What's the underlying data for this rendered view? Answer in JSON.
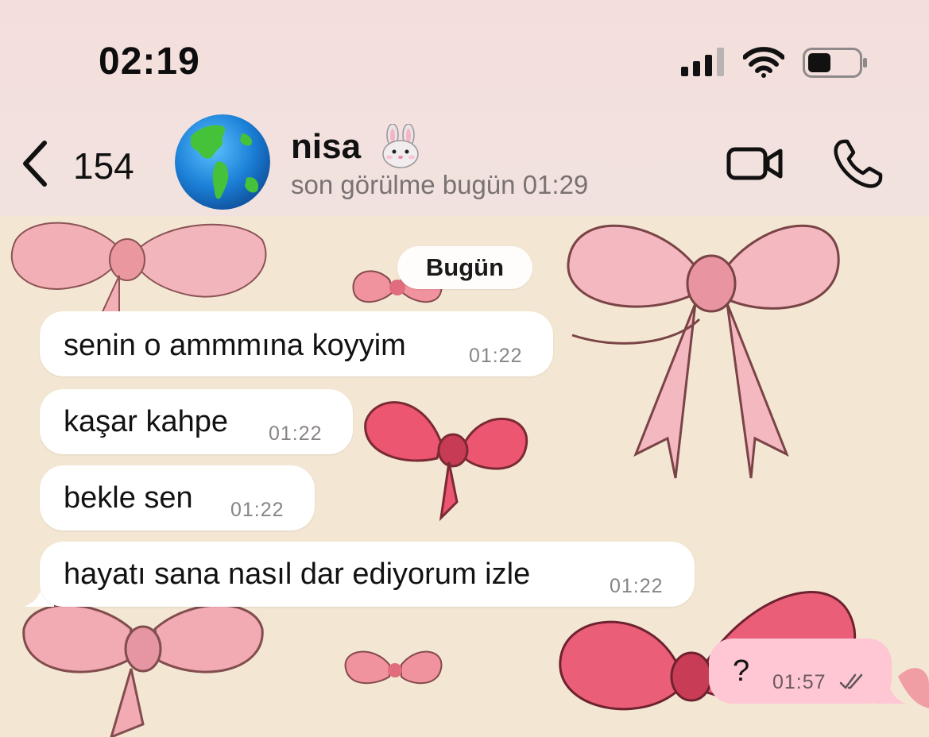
{
  "status_bar": {
    "time": "02:19",
    "icons": [
      "cellular-signal-icon",
      "wifi-icon",
      "battery-icon"
    ]
  },
  "header": {
    "back_count": "154",
    "contact_name": "nisa",
    "contact_emoji": "rabbit-face-emoji",
    "last_seen": "son görülme bugün 01:29",
    "avatar": "globe-americas-emoji",
    "actions": [
      "video-call-icon",
      "phone-call-icon"
    ]
  },
  "chat": {
    "day_label": "Bugün",
    "incoming": [
      {
        "text": "senin o ammmına koyyim",
        "time": "01:22"
      },
      {
        "text": "kaşar kahpe",
        "time": "01:22"
      },
      {
        "text": "bekle sen",
        "time": "01:22"
      },
      {
        "text": "hayatı sana nasıl dar ediyorum izle",
        "time": "01:22"
      }
    ],
    "outgoing": [
      {
        "text": "?",
        "time": "01:57",
        "status": "read-double-check"
      }
    ],
    "wallpaper": "pink-bows-pattern"
  },
  "colors": {
    "header_bg": "#f2e1de",
    "incoming_bubble": "#ffffff",
    "outgoing_bubble": "#ffc6d3",
    "wallpaper_bg": "#f3e7d3"
  }
}
